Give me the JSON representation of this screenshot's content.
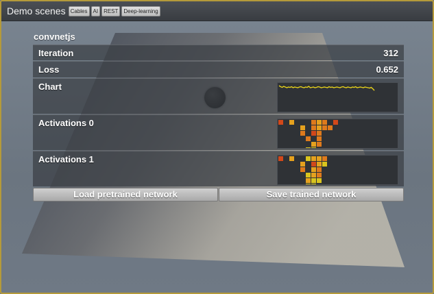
{
  "window": {
    "title": "Demo scenes",
    "tabs": [
      "Cables",
      "AI",
      "REST",
      "Deep-learning"
    ]
  },
  "panel": {
    "title": "convnetjs",
    "rows": {
      "iteration": {
        "label": "Iteration",
        "value": "312"
      },
      "loss": {
        "label": "Loss",
        "value": "0.652"
      },
      "chart": {
        "label": "Chart"
      },
      "activations0": {
        "label": "Activations 0"
      },
      "activations1": {
        "label": "Activations 1"
      }
    },
    "buttons": {
      "load": "Load pretrained network",
      "save": "Save trained network"
    }
  },
  "colors": {
    "chart_line": "#e8d21a",
    "frame_border": "#b59a3a",
    "activation_palette": [
      "#c0261b",
      "#d2481a",
      "#de7a1c",
      "#e5a11e",
      "#d9c41e",
      "#b5cf1e"
    ]
  },
  "loss_chart": {
    "type": "line",
    "values": [
      0.74,
      0.71,
      0.69,
      0.72,
      0.7,
      0.68,
      0.7,
      0.69,
      0.71,
      0.68,
      0.7,
      0.69,
      0.68,
      0.7,
      0.71,
      0.69,
      0.68,
      0.7,
      0.69,
      0.72,
      0.68,
      0.69,
      0.7,
      0.68,
      0.69,
      0.71,
      0.7,
      0.68,
      0.69,
      0.7,
      0.69,
      0.68,
      0.71,
      0.69,
      0.7,
      0.68,
      0.69,
      0.7,
      0.69,
      0.68,
      0.7,
      0.71,
      0.69,
      0.68,
      0.7,
      0.69,
      0.68,
      0.7,
      0.69,
      0.71,
      0.68,
      0.69,
      0.7,
      0.69,
      0.68,
      0.7,
      0.69,
      0.68,
      0.67,
      0.69,
      0.65,
      0.6
    ],
    "ylim": [
      0,
      0.8
    ]
  },
  "activations": [
    {
      "rows": [
        [
          1,
          0,
          3,
          0,
          0,
          0,
          2,
          3,
          2,
          0,
          1
        ],
        [
          0,
          0,
          0,
          0,
          3,
          0,
          2,
          3,
          2,
          2,
          0
        ],
        [
          0,
          0,
          0,
          0,
          2,
          0,
          1,
          2,
          0,
          0,
          0
        ],
        [
          0,
          0,
          0,
          0,
          0,
          2,
          0,
          2,
          0,
          0,
          0
        ],
        [
          0,
          0,
          0,
          0,
          0,
          0,
          3,
          2,
          0,
          0,
          0
        ],
        [
          0,
          0,
          0,
          0,
          0,
          4,
          4,
          0,
          0,
          0,
          0
        ]
      ]
    },
    {
      "rows": [
        [
          1,
          0,
          3,
          0,
          0,
          4,
          3,
          3,
          2,
          0,
          0
        ],
        [
          0,
          0,
          0,
          0,
          3,
          0,
          1,
          3,
          4,
          0,
          0
        ],
        [
          0,
          0,
          0,
          0,
          2,
          0,
          3,
          2,
          0,
          0,
          0
        ],
        [
          0,
          0,
          0,
          0,
          0,
          4,
          3,
          2,
          0,
          0,
          0
        ],
        [
          0,
          0,
          0,
          0,
          0,
          3,
          4,
          4,
          0,
          0,
          0
        ],
        [
          0,
          0,
          0,
          0,
          0,
          4,
          4,
          0,
          0,
          0,
          0
        ]
      ]
    }
  ]
}
